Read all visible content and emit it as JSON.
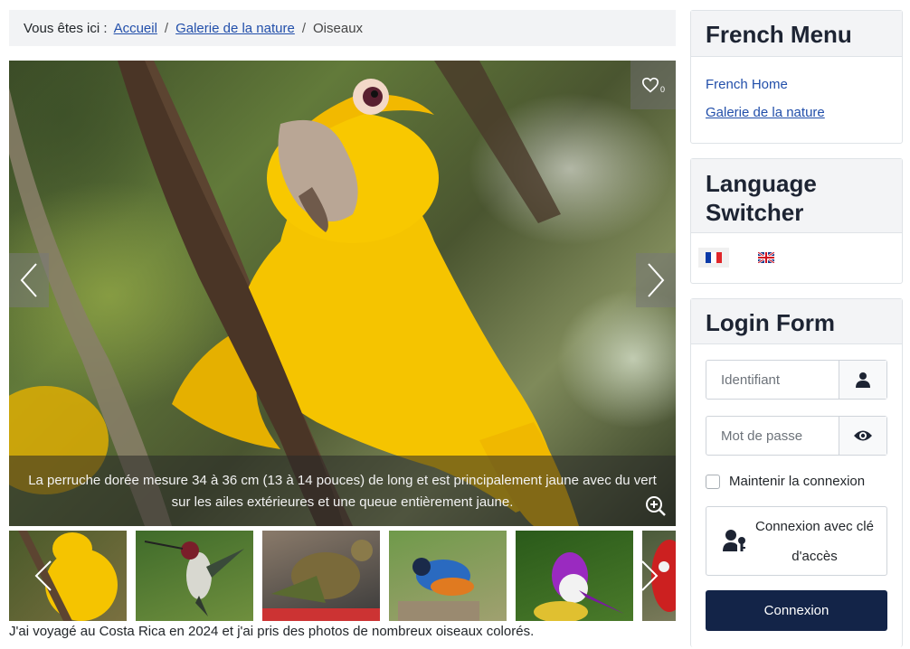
{
  "breadcrumb": {
    "prefix": "Vous êtes ici :",
    "items": [
      "Accueil",
      "Galerie de la nature"
    ],
    "separator": "/",
    "current": "Oiseaux"
  },
  "gallery": {
    "caption": "La perruche dorée mesure 34 à 36 cm (13 à 14 pouces) de long et est principalement jaune avec du vert sur les ailes extérieures et une queue entièrement jaune.",
    "favorites_count": "0",
    "description": "J'ai voyagé au Costa Rica en 2024 et j'ai pris des photos de nombreux oiseaux colorés."
  },
  "sidebar": {
    "menu": {
      "title": "French Menu",
      "links": [
        "French Home",
        "Galerie de la nature"
      ]
    },
    "language": {
      "title_line1": "Language",
      "title_line2": "Switcher",
      "flags": [
        "french-flag-icon",
        "uk-flag-icon"
      ]
    },
    "login": {
      "title": "Login Form",
      "username_placeholder": "Identifiant",
      "password_placeholder": "Mot de passe",
      "remember_label": "Maintenir la connexion",
      "passkey_line1": "Connexion avec clé",
      "passkey_line2": "d'accès",
      "submit_label": "Connexion"
    }
  },
  "colors": {
    "link": "#224faa",
    "primary_button": "#132448",
    "parrot_yellow": "#f5c400"
  }
}
